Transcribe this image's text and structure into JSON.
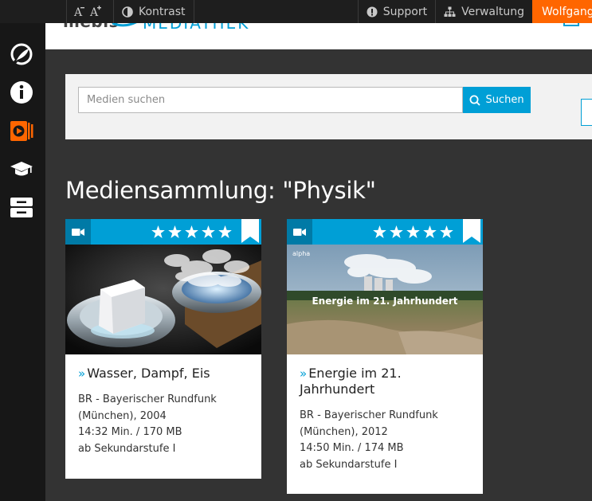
{
  "topbar": {
    "font_decrease_glyph": "A",
    "font_increase_glyph": "A",
    "contrast_label": "Kontrast",
    "support_label": "Support",
    "admin_label": "Verwaltung",
    "user_label": "Wolfgang R"
  },
  "header": {
    "logo_dark": "mebis",
    "logo_blue": "MEDIATHEK"
  },
  "sidebar": {
    "items": [
      {
        "icon": "leaf-icon"
      },
      {
        "icon": "info-icon"
      },
      {
        "icon": "media-library-icon",
        "active_color": "#ff6600"
      },
      {
        "icon": "graduation-cap-icon"
      },
      {
        "icon": "archive-icon"
      }
    ]
  },
  "search": {
    "placeholder": "Medien suchen",
    "button_label": "Suchen"
  },
  "page_title": "Mediensammlung: \"Physik\"",
  "cards": [
    {
      "title": "Wasser, Dampf, Eis",
      "rating": 5,
      "type_icon": "video-camera-icon",
      "publisher": "BR - Bayerischer Rundfunk",
      "city_year": "(München), 2004",
      "duration_size": "14:32 Min. / 170 MB",
      "level": "ab Sekundarstufe I"
    },
    {
      "title_line1": "Energie im 21.",
      "title_line2": "Jahrhundert",
      "rating": 5,
      "type_icon": "video-camera-icon",
      "thumb_overlay": "Energie im 21. Jahrhundert",
      "thumb_logo": "alpha",
      "publisher": "BR - Bayerischer Rundfunk",
      "city_year": "(München), 2012",
      "duration_size": "14:50 Min. / 174 MB",
      "level": "ab Sekundarstufe I"
    }
  ],
  "colors": {
    "accent": "#009fd6",
    "accent_dark": "#007aa6",
    "user_orange": "#ff6600",
    "background": "#333333",
    "sidebar": "#171717"
  }
}
